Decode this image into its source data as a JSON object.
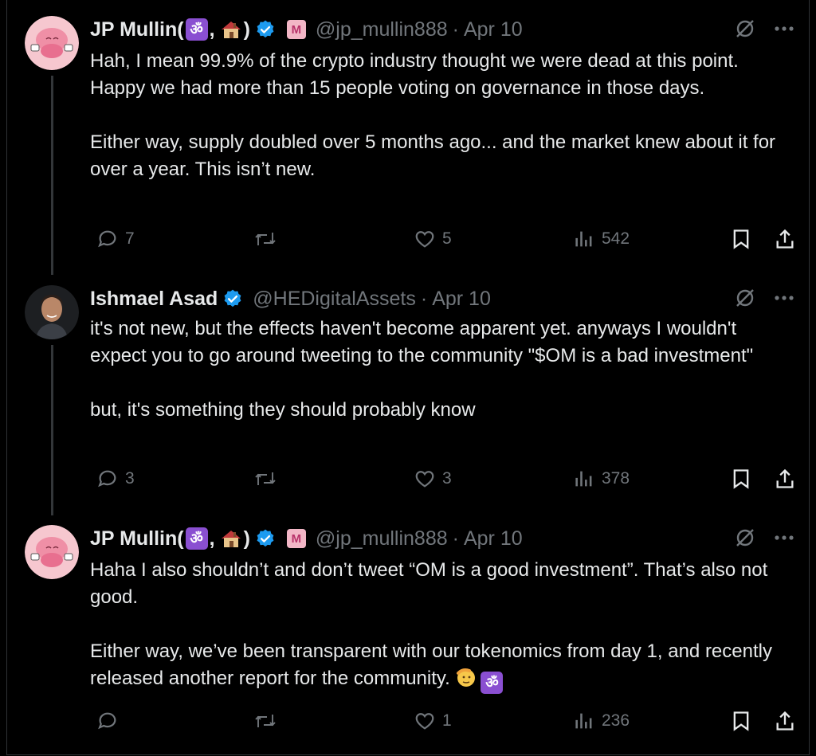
{
  "tweets": [
    {
      "name": "JP Mullin",
      "name_suffix_open": " (",
      "name_suffix_sep": ",",
      "name_suffix_close": ")",
      "om_glyph": "ॐ",
      "handle": "@jp_mullin888",
      "sep": "·",
      "date": "Apr 10",
      "text": "Hah, I mean 99.9% of the crypto industry thought we were dead at this point. Happy we had more than 15 people voting on governance in those days.\n\nEither way, supply doubled over 5 months ago... and the market knew about it for over a year. This isn’t new.",
      "replies": "7",
      "retweets": "",
      "likes": "5",
      "views": "542"
    },
    {
      "name": "Ishmael Asad",
      "handle": "@HEDigitalAssets",
      "sep": "·",
      "date": "Apr 10",
      "text": "it's not new, but the effects haven't become apparent yet. anyways I wouldn't expect you to go around tweeting to the community \"$OM is a bad investment\"\n\nbut, it's something they should probably know",
      "replies": "3",
      "retweets": "",
      "likes": "3",
      "views": "378"
    },
    {
      "name": "JP Mullin",
      "name_suffix_open": " (",
      "name_suffix_sep": ",",
      "name_suffix_close": ")",
      "om_glyph": "ॐ",
      "handle": "@jp_mullin888",
      "sep": "·",
      "date": "Apr 10",
      "text": "Haha I also shouldn’t and don’t tweet “OM is a good investment”. That’s also not good.\n\nEither way, we’ve been transparent with our tokenomics from day 1, and recently released another report for the community.",
      "replies": "",
      "retweets": "",
      "likes": "1",
      "views": "236"
    }
  ],
  "colors": {
    "background": "#000000",
    "text": "#e7e9ea",
    "muted": "#71767b",
    "verified": "#1d9bf0",
    "om_badge": "#8a4fd1"
  },
  "icons": [
    "grok-icon",
    "more-icon",
    "reply-icon",
    "retweet-icon",
    "like-icon",
    "views-icon",
    "bookmark-icon",
    "share-icon",
    "verified-icon",
    "m-badge-icon",
    "house-emoji-icon",
    "saluting-face-emoji-icon"
  ]
}
